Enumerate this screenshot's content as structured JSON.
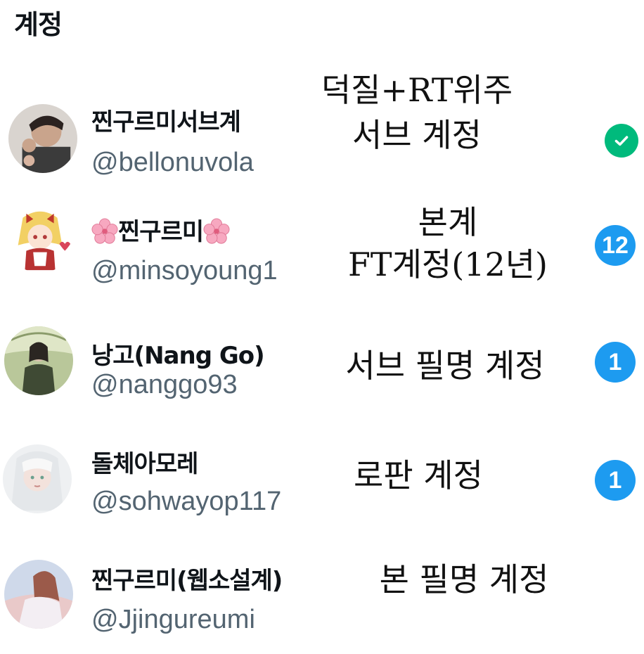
{
  "heading": "계정",
  "accounts": [
    {
      "display_name": "찐구르미서브계",
      "handle": "@bellonuvola",
      "note_lines": [
        "덕질+RT위주",
        "서브 계정"
      ],
      "status": "selected",
      "status_icon": "check-icon",
      "avatar_icon": "profile-photo-man"
    },
    {
      "display_name_prefix": "",
      "display_name": "찐구르미",
      "display_name_icons": [
        "cherry-blossom-icon",
        "cherry-blossom-icon"
      ],
      "handle": "@minsoyoung1",
      "note_lines": [
        "본계",
        "FT계정(12년)"
      ],
      "badge_count": "12",
      "avatar_icon": "profile-illustration-girl"
    },
    {
      "display_name": "낭고(Nang Go)",
      "handle": "@nanggo93",
      "note_lines": [
        "서브 필명 계정"
      ],
      "badge_count": "1",
      "avatar_icon": "profile-illustration-woman"
    },
    {
      "display_name": "돌체아모레",
      "handle": "@sohwayop117",
      "note_lines": [
        "로판 계정"
      ],
      "badge_count": "1",
      "avatar_icon": "profile-illustration-white-hair"
    },
    {
      "display_name": "찐구르미(웹소설계)",
      "handle": "@Jjingureumi",
      "note_lines": [
        "본 필명 계정"
      ],
      "avatar_icon": "profile-illustration-fantasy"
    }
  ],
  "colors": {
    "handle": "#536471",
    "badge_blue": "#1d9bf0",
    "check_green": "#00ba7c"
  }
}
